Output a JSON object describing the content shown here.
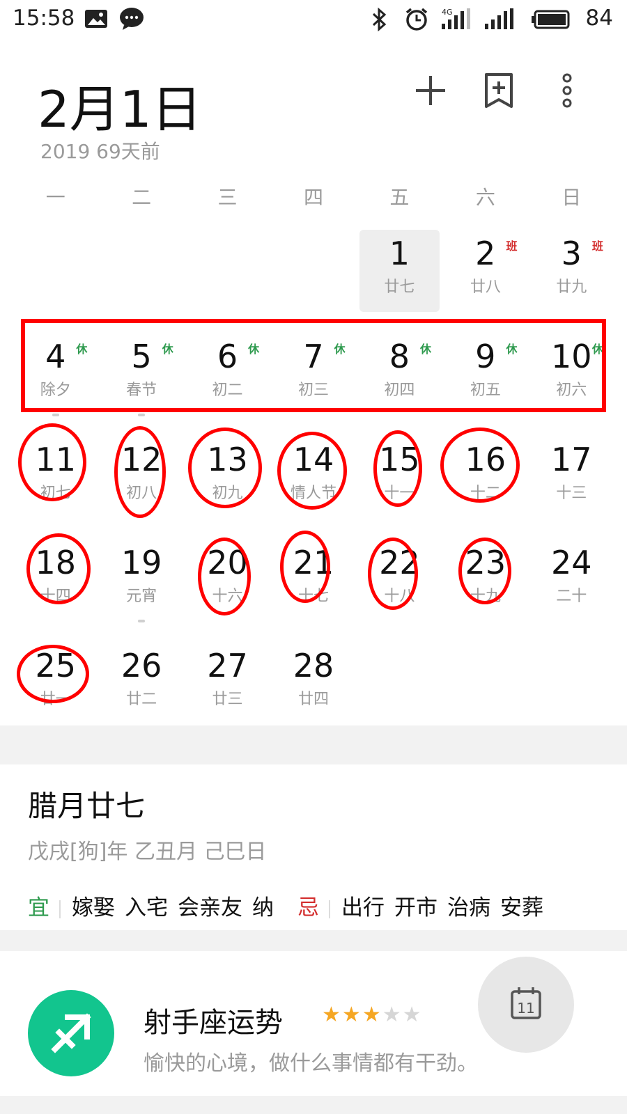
{
  "status_bar": {
    "time": "15:58",
    "battery": "84",
    "network": "4G",
    "icons": [
      "image-icon",
      "chat-icon",
      "bluetooth-icon",
      "alarm-icon",
      "signal-icon",
      "battery-icon"
    ]
  },
  "header": {
    "date_title": "2月1日",
    "subtitle": "2019 69天前",
    "actions": [
      "add-icon",
      "bookmark-add-icon",
      "more-icon"
    ]
  },
  "weekdays": [
    "一",
    "二",
    "三",
    "四",
    "五",
    "六",
    "日"
  ],
  "weeks": [
    [
      {
        "day": "",
        "lunar": ""
      },
      {
        "day": "",
        "lunar": ""
      },
      {
        "day": "",
        "lunar": ""
      },
      {
        "day": "",
        "lunar": ""
      },
      {
        "day": "1",
        "lunar": "廿七",
        "today": true
      },
      {
        "day": "2",
        "lunar": "廿八",
        "tag": "班",
        "tag_type": "ban"
      },
      {
        "day": "3",
        "lunar": "廿九",
        "tag": "班",
        "tag_type": "ban"
      }
    ],
    [
      {
        "day": "4",
        "lunar": "除夕",
        "tag": "休",
        "tag_type": "xiu",
        "dot": true
      },
      {
        "day": "5",
        "lunar": "春节",
        "tag": "休",
        "tag_type": "xiu",
        "dot": true
      },
      {
        "day": "6",
        "lunar": "初二",
        "tag": "休",
        "tag_type": "xiu"
      },
      {
        "day": "7",
        "lunar": "初三",
        "tag": "休",
        "tag_type": "xiu"
      },
      {
        "day": "8",
        "lunar": "初四",
        "tag": "休",
        "tag_type": "xiu"
      },
      {
        "day": "9",
        "lunar": "初五",
        "tag": "休",
        "tag_type": "xiu"
      },
      {
        "day": "10",
        "lunar": "初六",
        "tag": "休",
        "tag_type": "xiu"
      }
    ],
    [
      {
        "day": "11",
        "lunar": "初七"
      },
      {
        "day": "12",
        "lunar": "初八"
      },
      {
        "day": "13",
        "lunar": "初九"
      },
      {
        "day": "14",
        "lunar": "情人节"
      },
      {
        "day": "15",
        "lunar": "十一"
      },
      {
        "day": "16",
        "lunar": "十二"
      },
      {
        "day": "17",
        "lunar": "十三"
      }
    ],
    [
      {
        "day": "18",
        "lunar": "十四"
      },
      {
        "day": "19",
        "lunar": "元宵",
        "dot": true
      },
      {
        "day": "20",
        "lunar": "十六"
      },
      {
        "day": "21",
        "lunar": "十七"
      },
      {
        "day": "22",
        "lunar": "十八"
      },
      {
        "day": "23",
        "lunar": "十九"
      },
      {
        "day": "24",
        "lunar": "二十"
      }
    ],
    [
      {
        "day": "25",
        "lunar": "廿一"
      },
      {
        "day": "26",
        "lunar": "廿二"
      },
      {
        "day": "27",
        "lunar": "廿三"
      },
      {
        "day": "28",
        "lunar": "廿四"
      },
      {
        "day": "",
        "lunar": ""
      },
      {
        "day": "",
        "lunar": ""
      },
      {
        "day": "",
        "lunar": ""
      }
    ]
  ],
  "almanac": {
    "title": "腊月廿七",
    "ganzhi": "戊戌[狗]年 乙丑月 己巳日",
    "yi_label": "宜",
    "yi": [
      "嫁娶",
      "入宅",
      "会亲友",
      "纳"
    ],
    "ji_label": "忌",
    "ji": [
      "出行",
      "开市",
      "治病",
      "安葬"
    ]
  },
  "horoscope": {
    "title": "射手座运势",
    "rating": 3,
    "max_rating": 5,
    "description": "愉快的心境，做什么事情都有干劲。",
    "icon": "sagittarius-icon",
    "icon_color": "#12c58e"
  },
  "fab": {
    "label": "11",
    "icon": "today-calendar-icon"
  },
  "colors": {
    "holiday_tag": "#2e9a4e",
    "workday_tag": "#d32f2f",
    "annotation": "#ff0000"
  }
}
